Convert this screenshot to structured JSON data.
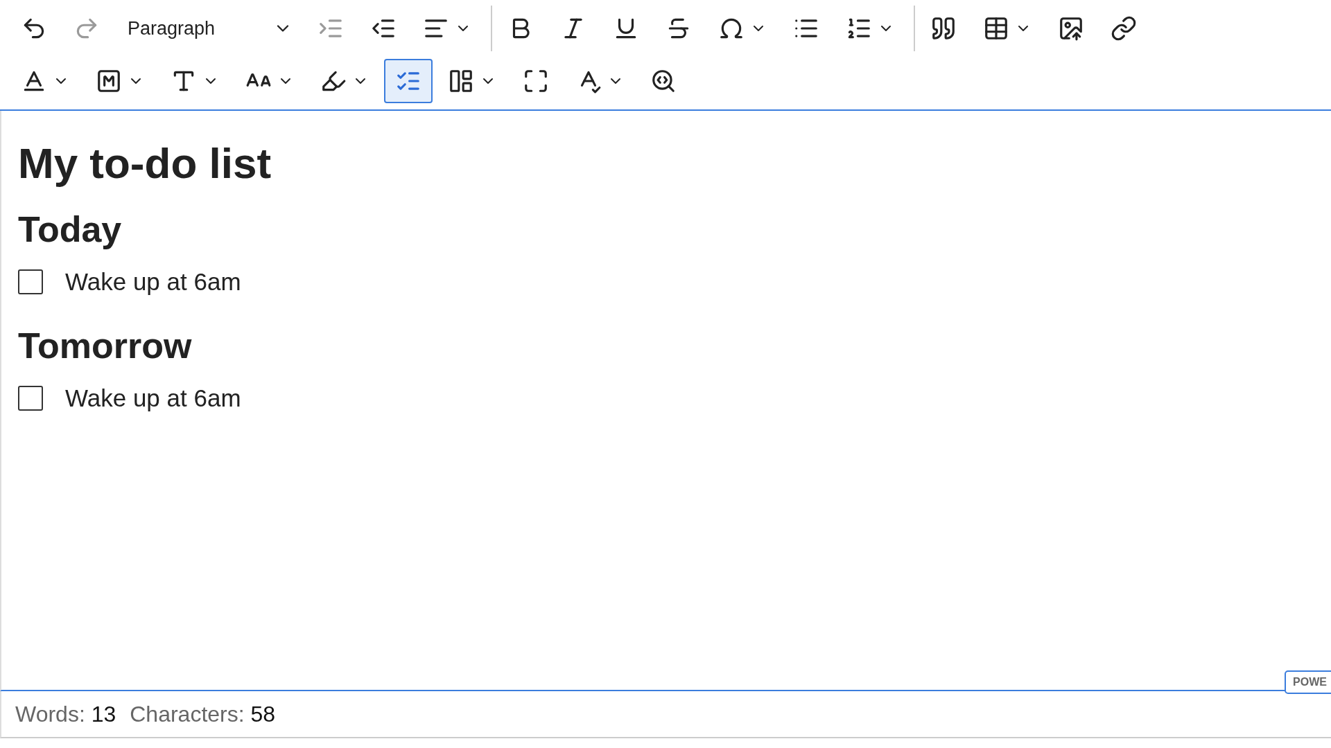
{
  "toolbar": {
    "rows": [
      [
        {
          "kind": "button",
          "disabled": false,
          "on": false
        },
        {
          "kind": "button",
          "disabled": true,
          "on": false
        },
        {
          "kind": "select",
          "value": "Paragraph"
        },
        {
          "kind": "button",
          "disabled": true,
          "on": false
        },
        {
          "kind": "button",
          "disabled": false,
          "on": false
        },
        {
          "kind": "split",
          "disabled": false,
          "on": false
        },
        {
          "kind": "separator"
        },
        {
          "kind": "button",
          "disabled": false,
          "on": false
        },
        {
          "kind": "button",
          "disabled": false,
          "on": false
        },
        {
          "kind": "button",
          "disabled": false,
          "on": false
        },
        {
          "kind": "button",
          "disabled": false,
          "on": false
        },
        {
          "kind": "split",
          "disabled": false,
          "on": false
        },
        {
          "kind": "button",
          "disabled": false,
          "on": false
        },
        {
          "kind": "split",
          "disabled": false,
          "on": false
        },
        {
          "kind": "separator"
        },
        {
          "kind": "button",
          "disabled": false,
          "on": false
        },
        {
          "kind": "split",
          "disabled": false,
          "on": false
        },
        {
          "kind": "button",
          "disabled": false,
          "on": false
        },
        {
          "kind": "button",
          "disabled": false,
          "on": false
        }
      ],
      [
        {
          "kind": "split",
          "disabled": false,
          "on": false
        },
        {
          "kind": "split",
          "disabled": false,
          "on": false
        },
        {
          "kind": "split",
          "disabled": false,
          "on": false
        },
        {
          "kind": "split",
          "disabled": false,
          "on": false
        },
        {
          "kind": "split",
          "disabled": false,
          "on": false
        },
        {
          "kind": "button",
          "disabled": false,
          "on": true
        },
        {
          "kind": "split",
          "disabled": false,
          "on": false
        },
        {
          "kind": "button",
          "disabled": false,
          "on": false
        },
        {
          "kind": "split",
          "disabled": false,
          "on": false
        },
        {
          "kind": "button",
          "disabled": false,
          "on": false
        }
      ]
    ]
  },
  "document": {
    "title": "My to-do list",
    "sections": [
      {
        "heading": "Today",
        "items": [
          {
            "text": "Wake up at 6am",
            "checked": false
          }
        ]
      },
      {
        "heading": "Tomorrow",
        "items": [
          {
            "text": "Wake up at 6am",
            "checked": false
          }
        ]
      }
    ]
  },
  "status_bar": {
    "words_label": "Words:",
    "words": "13",
    "characters_label": "Characters:",
    "characters": "58"
  },
  "badge": "POWE"
}
